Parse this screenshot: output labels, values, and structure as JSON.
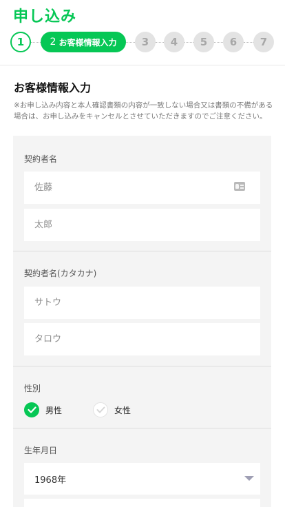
{
  "header": {
    "title": "申し込み"
  },
  "stepper": {
    "steps": [
      {
        "label": "1"
      },
      {
        "number": "2",
        "label": "お客様情報入力"
      },
      {
        "label": "3"
      },
      {
        "label": "4"
      },
      {
        "label": "5"
      },
      {
        "label": "6"
      },
      {
        "label": "7"
      }
    ],
    "current_step": 2
  },
  "section": {
    "title": "お客様情報入力",
    "notice": "※お申し込み内容と本人確認書類の内容が一致しない場合又は書類の不備がある場合は、お申し込みをキャンセルとさせていただきますのでご注意ください。"
  },
  "form": {
    "name": {
      "label": "契約者名",
      "last_placeholder": "佐藤",
      "first_placeholder": "太郎",
      "icon": "id-card-icon"
    },
    "kana": {
      "label": "契約者名(カタカナ)",
      "last_placeholder": "サトウ",
      "first_placeholder": "タロウ"
    },
    "gender": {
      "label": "性別",
      "options": [
        {
          "label": "男性",
          "selected": true
        },
        {
          "label": "女性",
          "selected": false
        }
      ]
    },
    "birthdate": {
      "label": "生年月日",
      "year_value": "1968年"
    }
  },
  "colors": {
    "accent": "#06c755",
    "step_inactive_bg": "#e3e3e3",
    "step_inactive_text": "#a7a7a7",
    "panel_bg": "#f4f4f4"
  }
}
